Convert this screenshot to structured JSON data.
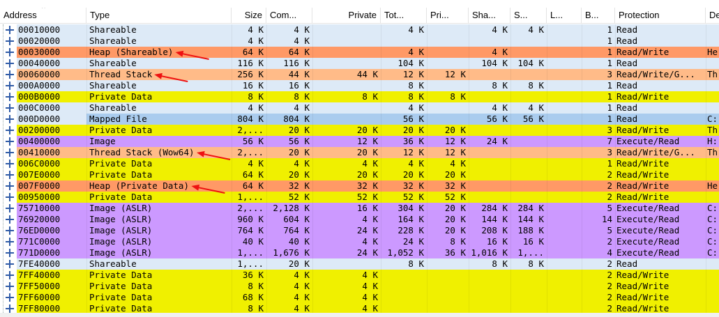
{
  "header": {
    "columns": [
      {
        "key": "address",
        "label": "Address"
      },
      {
        "key": "type",
        "label": "Type"
      },
      {
        "key": "size",
        "label": "Size"
      },
      {
        "key": "committed",
        "label": "Com..."
      },
      {
        "key": "private",
        "label": "Private"
      },
      {
        "key": "total_ws",
        "label": "Tot..."
      },
      {
        "key": "private_ws",
        "label": "Pri..."
      },
      {
        "key": "shareable_ws",
        "label": "Sha..."
      },
      {
        "key": "shared_ws",
        "label": "S..."
      },
      {
        "key": "locked_ws",
        "label": "L..."
      },
      {
        "key": "blocks",
        "label": "B..."
      },
      {
        "key": "protection",
        "label": "Protection"
      },
      {
        "key": "details",
        "label": "De"
      }
    ],
    "sort_indicator": "^"
  },
  "colors": {
    "shareable": "#ddeaf7",
    "heap": "#ff9966",
    "thread_stack": "#ffbb88",
    "private": "#f0f000",
    "image": "#cc99ff",
    "mapped": "#aaccee",
    "address_default": "#ddeaf7",
    "text": "#000000",
    "arrow": "#ee1111",
    "expander": "#2e5aa6"
  },
  "rows": [
    {
      "addr": "00010000",
      "type": "Shareable",
      "kind": "shareable",
      "size": "4 K",
      "com": "4 K",
      "priv": "",
      "tot": "4 K",
      "pri": "",
      "sha": "4 K",
      "s": "4 K",
      "l": "",
      "b": "1",
      "prot": "Read",
      "det": ""
    },
    {
      "addr": "00020000",
      "type": "Shareable",
      "kind": "shareable",
      "size": "4 K",
      "com": "4 K",
      "priv": "",
      "tot": "",
      "pri": "",
      "sha": "",
      "s": "",
      "l": "",
      "b": "1",
      "prot": "Read",
      "det": ""
    },
    {
      "addr": "00030000",
      "type": "Heap (Shareable)",
      "kind": "heap",
      "size": "64 K",
      "com": "64 K",
      "priv": "",
      "tot": "4 K",
      "pri": "",
      "sha": "4 K",
      "s": "",
      "l": "",
      "b": "1",
      "prot": "Read/Write",
      "det": "He"
    },
    {
      "addr": "00040000",
      "type": "Shareable",
      "kind": "shareable",
      "size": "116 K",
      "com": "116 K",
      "priv": "",
      "tot": "104 K",
      "pri": "",
      "sha": "104 K",
      "s": "104 K",
      "l": "",
      "b": "1",
      "prot": "Read",
      "det": ""
    },
    {
      "addr": "00060000",
      "type": "Thread Stack",
      "kind": "thread_stack",
      "size": "256 K",
      "com": "44 K",
      "priv": "44 K",
      "tot": "12 K",
      "pri": "12 K",
      "sha": "",
      "s": "",
      "l": "",
      "b": "3",
      "prot": "Read/Write/G...",
      "det": "Th"
    },
    {
      "addr": "000A0000",
      "type": "Shareable",
      "kind": "shareable",
      "size": "16 K",
      "com": "16 K",
      "priv": "",
      "tot": "8 K",
      "pri": "",
      "sha": "8 K",
      "s": "8 K",
      "l": "",
      "b": "1",
      "prot": "Read",
      "det": ""
    },
    {
      "addr": "000B0000",
      "type": "Private Data",
      "kind": "private",
      "size": "8 K",
      "com": "8 K",
      "priv": "8 K",
      "tot": "8 K",
      "pri": "8 K",
      "sha": "",
      "s": "",
      "l": "",
      "b": "1",
      "prot": "Read/Write",
      "det": ""
    },
    {
      "addr": "000C0000",
      "type": "Shareable",
      "kind": "shareable",
      "size": "4 K",
      "com": "4 K",
      "priv": "",
      "tot": "4 K",
      "pri": "",
      "sha": "4 K",
      "s": "4 K",
      "l": "",
      "b": "1",
      "prot": "Read",
      "det": ""
    },
    {
      "addr": "000D0000",
      "type": "Mapped File",
      "kind": "mapped",
      "size": "804 K",
      "com": "804 K",
      "priv": "",
      "tot": "56 K",
      "pri": "",
      "sha": "56 K",
      "s": "56 K",
      "l": "",
      "b": "1",
      "prot": "Read",
      "det": "C:"
    },
    {
      "addr": "00200000",
      "type": "Private Data",
      "kind": "private",
      "size": "2,...",
      "com": "20 K",
      "priv": "20 K",
      "tot": "20 K",
      "pri": "20 K",
      "sha": "",
      "s": "",
      "l": "",
      "b": "3",
      "prot": "Read/Write",
      "det": "Th"
    },
    {
      "addr": "00400000",
      "type": "Image",
      "kind": "image",
      "size": "56 K",
      "com": "56 K",
      "priv": "12 K",
      "tot": "36 K",
      "pri": "12 K",
      "sha": "24 K",
      "s": "",
      "l": "",
      "b": "7",
      "prot": "Execute/Read",
      "det": "H:"
    },
    {
      "addr": "00410000",
      "type": "Thread Stack (Wow64)",
      "kind": "thread_stack",
      "size": "2,...",
      "com": "20 K",
      "priv": "20 K",
      "tot": "12 K",
      "pri": "12 K",
      "sha": "",
      "s": "",
      "l": "",
      "b": "3",
      "prot": "Read/Write/G...",
      "det": "Th"
    },
    {
      "addr": "006C0000",
      "type": "Private Data",
      "kind": "private",
      "size": "4 K",
      "com": "4 K",
      "priv": "4 K",
      "tot": "4 K",
      "pri": "4 K",
      "sha": "",
      "s": "",
      "l": "",
      "b": "1",
      "prot": "Read/Write",
      "det": ""
    },
    {
      "addr": "007E0000",
      "type": "Private Data",
      "kind": "private",
      "size": "64 K",
      "com": "20 K",
      "priv": "20 K",
      "tot": "20 K",
      "pri": "20 K",
      "sha": "",
      "s": "",
      "l": "",
      "b": "2",
      "prot": "Read/Write",
      "det": ""
    },
    {
      "addr": "007F0000",
      "type": "Heap (Private Data)",
      "kind": "heap",
      "size": "64 K",
      "com": "32 K",
      "priv": "32 K",
      "tot": "32 K",
      "pri": "32 K",
      "sha": "",
      "s": "",
      "l": "",
      "b": "2",
      "prot": "Read/Write",
      "det": "He"
    },
    {
      "addr": "00950000",
      "type": "Private Data",
      "kind": "private",
      "size": "1,...",
      "com": "52 K",
      "priv": "52 K",
      "tot": "52 K",
      "pri": "52 K",
      "sha": "",
      "s": "",
      "l": "",
      "b": "2",
      "prot": "Read/Write",
      "det": ""
    },
    {
      "addr": "75710000",
      "type": "Image (ASLR)",
      "kind": "image",
      "size": "2,...",
      "com": "2,128 K",
      "priv": "16 K",
      "tot": "304 K",
      "pri": "20 K",
      "sha": "284 K",
      "s": "284 K",
      "l": "",
      "b": "5",
      "prot": "Execute/Read",
      "det": "C:"
    },
    {
      "addr": "76920000",
      "type": "Image (ASLR)",
      "kind": "image",
      "size": "960 K",
      "com": "604 K",
      "priv": "4 K",
      "tot": "164 K",
      "pri": "20 K",
      "sha": "144 K",
      "s": "144 K",
      "l": "",
      "b": "14",
      "prot": "Execute/Read",
      "det": "C:"
    },
    {
      "addr": "76ED0000",
      "type": "Image (ASLR)",
      "kind": "image",
      "size": "764 K",
      "com": "764 K",
      "priv": "24 K",
      "tot": "228 K",
      "pri": "20 K",
      "sha": "208 K",
      "s": "188 K",
      "l": "",
      "b": "5",
      "prot": "Execute/Read",
      "det": "C:"
    },
    {
      "addr": "771C0000",
      "type": "Image (ASLR)",
      "kind": "image",
      "size": "40 K",
      "com": "40 K",
      "priv": "4 K",
      "tot": "24 K",
      "pri": "8 K",
      "sha": "16 K",
      "s": "16 K",
      "l": "",
      "b": "2",
      "prot": "Execute/Read",
      "det": "C:"
    },
    {
      "addr": "771D0000",
      "type": "Image (ASLR)",
      "kind": "image",
      "size": "1,...",
      "com": "1,676 K",
      "priv": "24 K",
      "tot": "1,052 K",
      "pri": "36 K",
      "sha": "1,016 K",
      "s": "1,...",
      "l": "",
      "b": "4",
      "prot": "Execute/Read",
      "det": "C:"
    },
    {
      "addr": "7FE40000",
      "type": "Shareable",
      "kind": "shareable",
      "size": "1,...",
      "com": "20 K",
      "priv": "",
      "tot": "8 K",
      "pri": "",
      "sha": "8 K",
      "s": "8 K",
      "l": "",
      "b": "2",
      "prot": "Read",
      "det": ""
    },
    {
      "addr": "7FF40000",
      "type": "Private Data",
      "kind": "private",
      "size": "36 K",
      "com": "4 K",
      "priv": "4 K",
      "tot": "",
      "pri": "",
      "sha": "",
      "s": "",
      "l": "",
      "b": "2",
      "prot": "Read/Write",
      "det": ""
    },
    {
      "addr": "7FF50000",
      "type": "Private Data",
      "kind": "private",
      "size": "8 K",
      "com": "4 K",
      "priv": "4 K",
      "tot": "",
      "pri": "",
      "sha": "",
      "s": "",
      "l": "",
      "b": "2",
      "prot": "Read/Write",
      "det": ""
    },
    {
      "addr": "7FF60000",
      "type": "Private Data",
      "kind": "private",
      "size": "68 K",
      "com": "4 K",
      "priv": "4 K",
      "tot": "",
      "pri": "",
      "sha": "",
      "s": "",
      "l": "",
      "b": "2",
      "prot": "Read/Write",
      "det": ""
    },
    {
      "addr": "7FF80000",
      "type": "Private Data",
      "kind": "private",
      "size": "8 K",
      "com": "4 K",
      "priv": "4 K",
      "tot": "",
      "pri": "",
      "sha": "",
      "s": "",
      "l": "",
      "b": "2",
      "prot": "Read/Write",
      "det": ""
    }
  ],
  "annotations": {
    "arrow_targets": [
      "00030000",
      "00060000",
      "00410000",
      "007F0000"
    ]
  }
}
